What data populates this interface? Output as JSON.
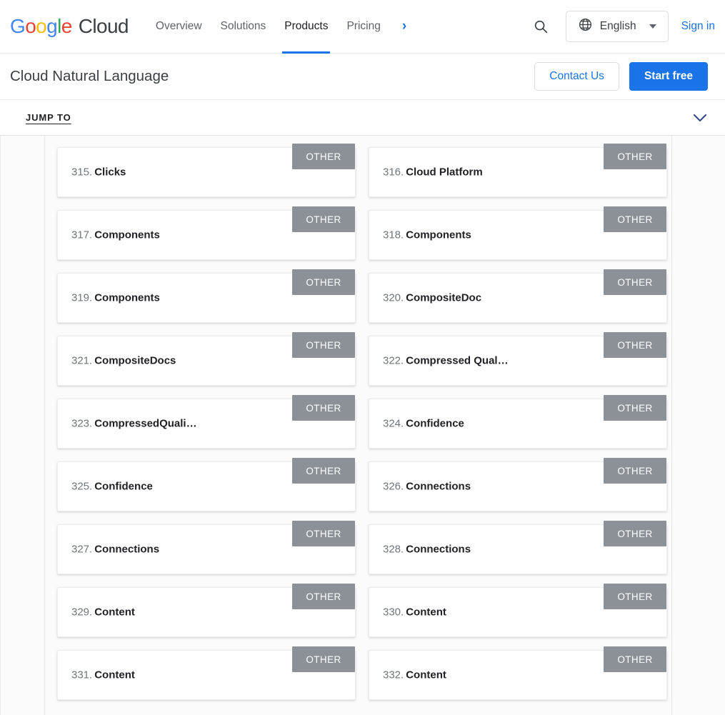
{
  "header": {
    "logo": {
      "google": "Google",
      "cloud": "Cloud"
    },
    "nav": [
      {
        "label": "Overview",
        "active": false
      },
      {
        "label": "Solutions",
        "active": false
      },
      {
        "label": "Products",
        "active": true
      },
      {
        "label": "Pricing",
        "active": false
      }
    ],
    "more_chevron": "›",
    "search_icon": "search-icon",
    "language": {
      "label": "English",
      "icon": "globe-icon"
    },
    "sign_in": "Sign in"
  },
  "product_bar": {
    "title": "Cloud Natural Language",
    "contact_label": "Contact Us",
    "start_free_label": "Start free"
  },
  "jump_bar": {
    "label": "JUMP TO",
    "chevron": "chevron-down-icon"
  },
  "colors": {
    "accent_blue": "#1a73e8",
    "badge_gray": "#8b9197",
    "text_primary": "#202124",
    "text_secondary": "#5f6368",
    "page_bg": "#fbfbfb"
  },
  "entities": [
    {
      "index": "315.",
      "name": "Clicks",
      "badge": "OTHER"
    },
    {
      "index": "316.",
      "name": "Cloud Platform",
      "badge": "OTHER"
    },
    {
      "index": "317.",
      "name": "Components",
      "badge": "OTHER"
    },
    {
      "index": "318.",
      "name": "Components",
      "badge": "OTHER"
    },
    {
      "index": "319.",
      "name": "Components",
      "badge": "OTHER"
    },
    {
      "index": "320.",
      "name": "CompositeDoc",
      "badge": "OTHER"
    },
    {
      "index": "321.",
      "name": "CompositeDocs",
      "badge": "OTHER"
    },
    {
      "index": "322.",
      "name": "Compressed Qual…",
      "badge": "OTHER"
    },
    {
      "index": "323.",
      "name": "CompressedQuali…",
      "badge": "OTHER"
    },
    {
      "index": "324.",
      "name": "Confidence",
      "badge": "OTHER"
    },
    {
      "index": "325.",
      "name": "Confidence",
      "badge": "OTHER"
    },
    {
      "index": "326.",
      "name": "Connections",
      "badge": "OTHER"
    },
    {
      "index": "327.",
      "name": "Connections",
      "badge": "OTHER"
    },
    {
      "index": "328.",
      "name": "Connections",
      "badge": "OTHER"
    },
    {
      "index": "329.",
      "name": "Content",
      "badge": "OTHER"
    },
    {
      "index": "330.",
      "name": "Content",
      "badge": "OTHER"
    },
    {
      "index": "331.",
      "name": "Content",
      "badge": "OTHER"
    },
    {
      "index": "332.",
      "name": "Content",
      "badge": "OTHER"
    }
  ]
}
